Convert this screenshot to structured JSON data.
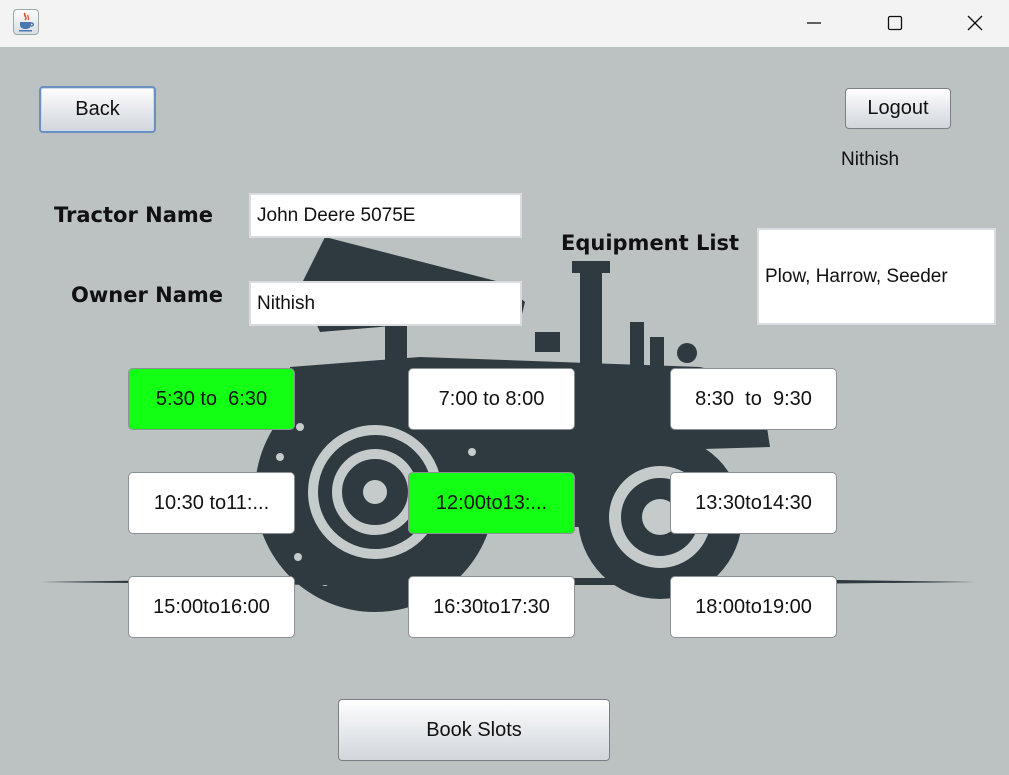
{
  "window": {
    "app_icon": "java-coffee-cup-icon"
  },
  "buttons": {
    "back": "Back",
    "logout": "Logout",
    "book_slots": "Book Slots"
  },
  "user": {
    "name": "Nithish"
  },
  "form": {
    "tractor_name_label": "Tractor Name",
    "tractor_name_value": "John Deere 5075E",
    "owner_name_label": "Owner Name",
    "owner_name_value": "Nithish",
    "equipment_label": "Equipment List",
    "equipment_value": "Plow, Harrow, Seeder"
  },
  "slots": [
    {
      "label": "5:30 to  6:30",
      "booked": true
    },
    {
      "label": "7:00 to 8:00",
      "booked": false
    },
    {
      "label": "8:30  to  9:30",
      "booked": false
    },
    {
      "label": "10:30 to11:...",
      "booked": false
    },
    {
      "label": "12:00to13:...",
      "booked": true
    },
    {
      "label": "13:30to14:30",
      "booked": false
    },
    {
      "label": "15:00to16:00",
      "booked": false
    },
    {
      "label": "16:30to17:30",
      "booked": false
    },
    {
      "label": "18:00to19:00",
      "booked": false
    }
  ],
  "colors": {
    "booked": "#13ff13",
    "available": "#ffffff",
    "background": "#bcc2c2"
  }
}
